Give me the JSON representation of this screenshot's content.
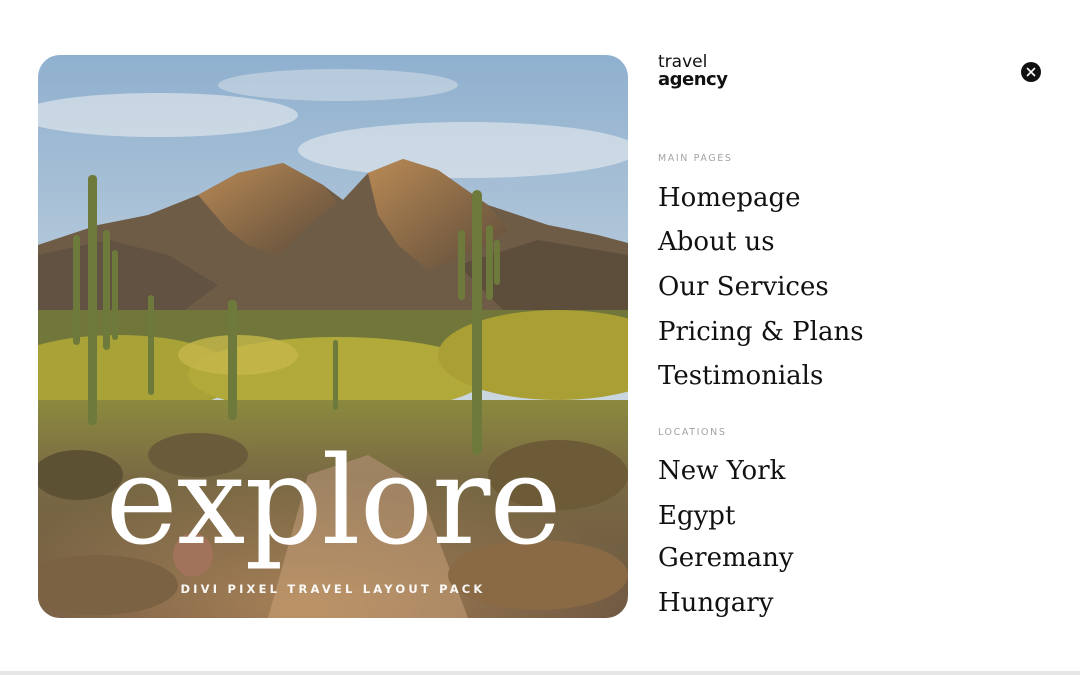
{
  "hero": {
    "headline": "explore",
    "tagline": "DIVI PIXEL TRAVEL LAYOUT PACK",
    "image": "desert-mountain-cactus-photo"
  },
  "brand": {
    "line1": "travel",
    "line2": "agency"
  },
  "close": {
    "icon": "close-icon"
  },
  "menu": {
    "main_pages_label": "MAIN PAGES",
    "main_pages": [
      {
        "label": "Homepage"
      },
      {
        "label": "About us"
      },
      {
        "label": "Our Services"
      },
      {
        "label": "Pricing & Plans"
      },
      {
        "label": "Testimonials"
      }
    ],
    "locations_label": "LOCATIONS",
    "locations": [
      {
        "label": "New York"
      },
      {
        "label": "Egypt"
      },
      {
        "label": "Geremany"
      },
      {
        "label": "Hungary"
      }
    ]
  },
  "colors": {
    "text": "#111111",
    "section_label": "#a3a3a3",
    "background": "#ffffff"
  }
}
